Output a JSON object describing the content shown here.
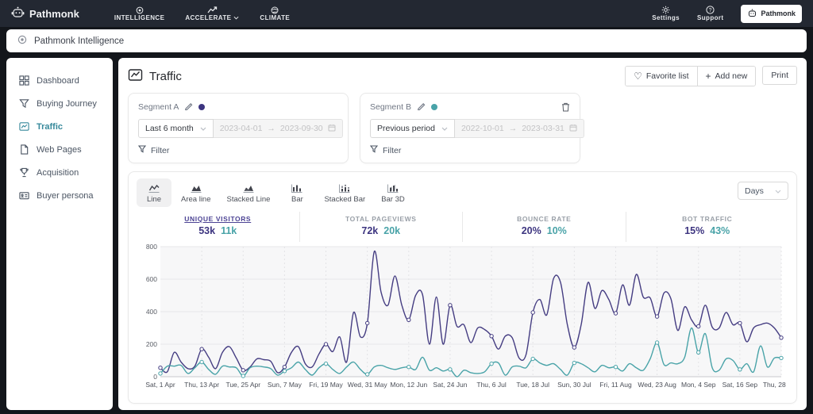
{
  "header": {
    "brand": "Pathmonk",
    "nav": [
      {
        "label": "INTELLIGENCE",
        "icon": "intelligence-icon",
        "has_caret": false
      },
      {
        "label": "ACCELERATE",
        "icon": "accelerate-icon",
        "has_caret": true
      },
      {
        "label": "CLIMATE",
        "icon": "climate-icon",
        "has_caret": false
      }
    ],
    "utilities": [
      {
        "label": "Settings",
        "icon": "gear-icon"
      },
      {
        "label": "Support",
        "icon": "question-icon"
      }
    ],
    "account_button": "Pathmonk"
  },
  "breadcrumb": {
    "label": "Pathmonk Intelligence"
  },
  "sidebar": {
    "items": [
      {
        "label": "Dashboard",
        "icon": "dashboard-icon",
        "active": false
      },
      {
        "label": "Buying Journey",
        "icon": "funnel-icon",
        "active": false
      },
      {
        "label": "Traffic",
        "icon": "line-chart-icon",
        "active": true
      },
      {
        "label": "Web Pages",
        "icon": "document-icon",
        "active": false
      },
      {
        "label": "Acquisition",
        "icon": "trophy-icon",
        "active": false
      },
      {
        "label": "Buyer persona",
        "icon": "id-card-icon",
        "active": false
      }
    ]
  },
  "page": {
    "title": "Traffic",
    "actions": {
      "favorite": "Favorite list",
      "add_new": "Add new",
      "print": "Print"
    }
  },
  "segments": [
    {
      "name": "Segment A",
      "color": "#3d3580",
      "period_option": "Last 6 month",
      "date_from": "2023-04-01",
      "date_to": "2023-09-30",
      "arrow": "→",
      "filter_label": "Filter",
      "deletable": false
    },
    {
      "name": "Segment B",
      "color": "#49a3a8",
      "period_option": "Previous period",
      "date_from": "2022-10-01",
      "date_to": "2023-03-31",
      "arrow": "→",
      "filter_label": "Filter",
      "deletable": true
    }
  ],
  "chart_controls": {
    "types": [
      {
        "label": "Line",
        "icon": "line-type-icon",
        "active": true
      },
      {
        "label": "Area line",
        "icon": "area-type-icon",
        "active": false
      },
      {
        "label": "Stacked Line",
        "icon": "stacked-line-type-icon",
        "active": false
      },
      {
        "label": "Bar",
        "icon": "bar-type-icon",
        "active": false
      },
      {
        "label": "Stacked Bar",
        "icon": "stacked-bar-type-icon",
        "active": false
      },
      {
        "label": "Bar 3D",
        "icon": "bar3d-type-icon",
        "active": false
      }
    ],
    "granularity": "Days"
  },
  "stats": [
    {
      "label": "UNIQUE VISITORS",
      "value_a": "53k",
      "value_b": "11k",
      "selected": true
    },
    {
      "label": "TOTAL PAGEVIEWS",
      "value_a": "72k",
      "value_b": "20k",
      "selected": false
    },
    {
      "label": "BOUNCE RATE",
      "value_a": "20%",
      "value_b": "10%",
      "selected": false
    },
    {
      "label": "BOT TRAFFIC",
      "value_a": "15%",
      "value_b": "43%",
      "selected": false
    }
  ],
  "chart_data": {
    "type": "line",
    "title": "Traffic unique visitors per day, Segment A vs Segment B",
    "ylim": [
      0,
      800
    ],
    "y_ticks": [
      0,
      200,
      400,
      600,
      800
    ],
    "x_tick_labels": [
      "Sat, 1 Apr",
      "Thu, 13 Apr",
      "Tue, 25 Apr",
      "Sun, 7 May",
      "Fri, 19 May",
      "Wed, 31 May",
      "Mon, 12 Jun",
      "Sat, 24 Jun",
      "Thu, 6 Jul",
      "Tue, 18 Jul",
      "Sun, 30 Jul",
      "Fri, 11 Aug",
      "Wed, 23 Aug",
      "Mon, 4 Sep",
      "Sat, 16 Sep",
      "Thu, 28 Sep"
    ],
    "x_tick_days": [
      0,
      12,
      24,
      36,
      48,
      60,
      72,
      84,
      96,
      108,
      120,
      132,
      144,
      156,
      168,
      180
    ],
    "total_days": 180,
    "sample_interval_days": 2,
    "grid": true,
    "legend": "none",
    "series": [
      {
        "name": "Segment A",
        "color": "#453d82",
        "values": [
          55,
          30,
          150,
          90,
          50,
          65,
          170,
          120,
          50,
          150,
          185,
          115,
          40,
          60,
          110,
          105,
          95,
          25,
          60,
          150,
          185,
          80,
          60,
          140,
          200,
          155,
          245,
          90,
          395,
          245,
          330,
          770,
          520,
          440,
          620,
          440,
          350,
          500,
          505,
          200,
          490,
          200,
          440,
          310,
          320,
          210,
          300,
          290,
          250,
          170,
          250,
          240,
          115,
          135,
          395,
          475,
          380,
          605,
          580,
          320,
          180,
          320,
          580,
          420,
          530,
          475,
          390,
          565,
          440,
          630,
          490,
          485,
          370,
          515,
          480,
          285,
          430,
          350,
          310,
          440,
          305,
          300,
          395,
          320,
          330,
          215,
          300,
          320,
          330,
          300,
          240
        ]
      },
      {
        "name": "Segment B",
        "color": "#49a3a8",
        "values": [
          20,
          65,
          65,
          70,
          20,
          55,
          90,
          45,
          15,
          65,
          60,
          55,
          5,
          55,
          65,
          60,
          50,
          10,
          35,
          55,
          90,
          45,
          10,
          55,
          80,
          45,
          20,
          60,
          90,
          45,
          15,
          60,
          70,
          55,
          45,
          55,
          60,
          45,
          120,
          40,
          55,
          35,
          45,
          0,
          40,
          25,
          20,
          30,
          80,
          85,
          10,
          60,
          65,
          55,
          110,
          85,
          70,
          80,
          45,
          10,
          85,
          80,
          55,
          30,
          70,
          55,
          60,
          35,
          80,
          55,
          40,
          110,
          210,
          75,
          85,
          80,
          120,
          300,
          150,
          265,
          55,
          40,
          110,
          100,
          45,
          80,
          30,
          190,
          60,
          115,
          115
        ]
      }
    ]
  }
}
